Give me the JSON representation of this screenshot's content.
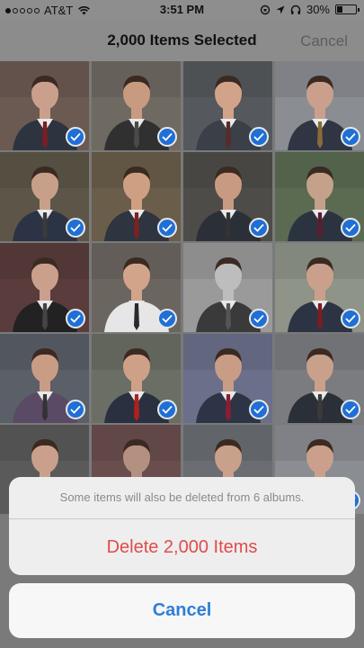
{
  "status_bar": {
    "carrier": "AT&T",
    "time": "3:51 PM",
    "battery": "30%",
    "battery_level": 0.3,
    "icons": [
      "signal-dots-icon",
      "wifi-icon",
      "rotation-lock-icon",
      "location-arrow-icon",
      "headphones-icon",
      "battery-icon"
    ]
  },
  "navbar": {
    "title": "2,000 Items Selected",
    "cancel_label": "Cancel"
  },
  "grid": {
    "selected_icon": "checkmark-icon",
    "tiles": [
      {
        "bg": "#6b5a52",
        "skin": "#caa08c",
        "suit": "#2d3440",
        "tie": "#7a1e22",
        "selected": true
      },
      {
        "bg": "#6e6a62",
        "skin": "#c89a80",
        "suit": "#303030",
        "tie": "#4a4a4a",
        "selected": true
      },
      {
        "bg": "#55585c",
        "skin": "#d1a48a",
        "suit": "#3a3f48",
        "tie": "#5a2a2a",
        "selected": true
      },
      {
        "bg": "#8a8d92",
        "skin": "#caa08c",
        "suit": "#2f3542",
        "tie": "#8a6a3a",
        "selected": true
      },
      {
        "bg": "#5d5648",
        "skin": "#c8a08a",
        "suit": "#2b3344",
        "tie": "#3a3a3a",
        "selected": true
      },
      {
        "bg": "#6a5d4a",
        "skin": "#cf9f84",
        "suit": "#2e3440",
        "tie": "#7a2222",
        "selected": true
      },
      {
        "bg": "#4e4c48",
        "skin": "#c99a82",
        "suit": "#2b2f38",
        "tie": "#333333",
        "selected": true
      },
      {
        "bg": "#5b6b52",
        "skin": "#c5a08a",
        "suit": "#2c3340",
        "tie": "#5a1e2a",
        "selected": true
      },
      {
        "bg": "#5a3c3c",
        "skin": "#caa08c",
        "suit": "#222222",
        "tie": "#444444",
        "selected": true
      },
      {
        "bg": "#6b6560",
        "skin": "#d2a48a",
        "suit": "#e6e6e6",
        "tie": "#2a2a2a",
        "selected": true
      },
      {
        "bg": "#9a9a9a",
        "skin": "#bdbdbd",
        "suit": "#3a3a3a",
        "tie": "#555555",
        "selected": true
      },
      {
        "bg": "#8e9488",
        "skin": "#caa08c",
        "suit": "#2c3342",
        "tie": "#7a1e22",
        "selected": true
      },
      {
        "bg": "#5a5f68",
        "skin": "#c99c86",
        "suit": "#5a4a66",
        "tie": "#333333",
        "selected": true
      },
      {
        "bg": "#6a6e64",
        "skin": "#cfa088",
        "suit": "#2a3040",
        "tie": "#b02020",
        "selected": true
      },
      {
        "bg": "#6b6f8a",
        "skin": "#c99c86",
        "suit": "#2d3446",
        "tie": "#8a1e30",
        "selected": true
      },
      {
        "bg": "#7a7c80",
        "skin": "#c9a08a",
        "suit": "#2b2f38",
        "tie": "#3a3a3a",
        "selected": true
      },
      {
        "bg": "#5a5a5a",
        "skin": "#caa08c",
        "suit": "#2f3540",
        "tie": "#444444",
        "selected": false
      },
      {
        "bg": "#6a4e4e",
        "skin": "#b49080",
        "suit": "#444444",
        "tie": "#555555",
        "selected": false
      },
      {
        "bg": "#6a6e72",
        "skin": "#c9a08a",
        "suit": "#3a3f48",
        "tie": "#333333",
        "selected": false
      },
      {
        "bg": "#8a8d92",
        "skin": "#caa08c",
        "suit": "#2d3342",
        "tie": "#7a1e22",
        "selected": true
      }
    ]
  },
  "action_sheet": {
    "message": "Some items will also be deleted from 6 albums.",
    "delete_label": "Delete 2,000 Items",
    "cancel_label": "Cancel",
    "colors": {
      "destructive": "#e24a4a",
      "cancel": "#2f7ed8"
    }
  }
}
